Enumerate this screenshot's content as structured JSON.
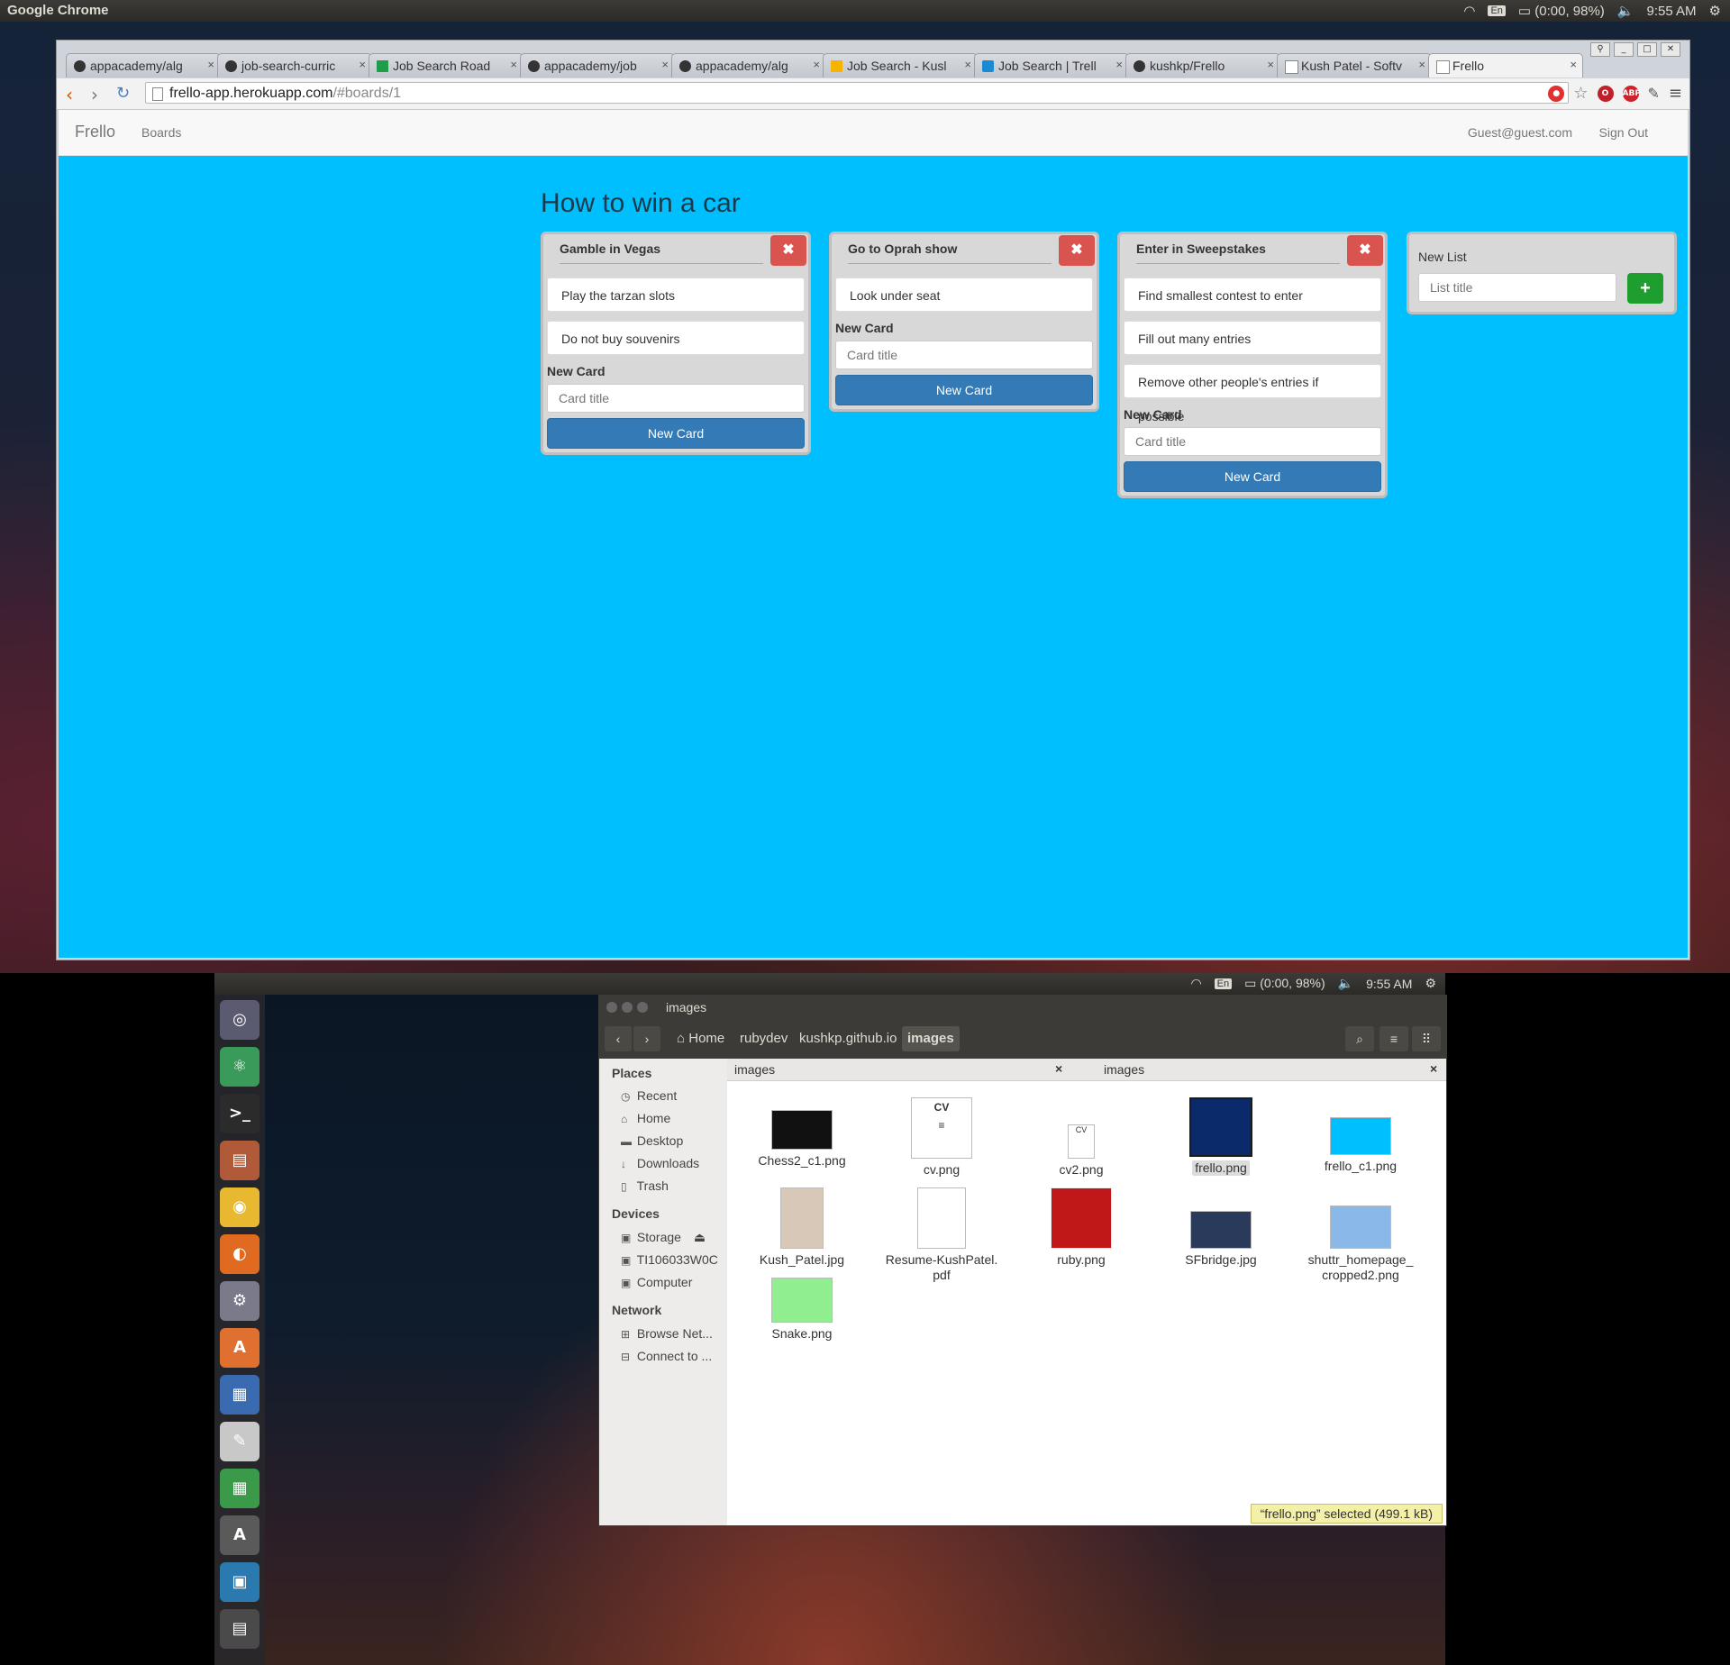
{
  "system": {
    "app_name": "Google Chrome",
    "kbd": "En",
    "battery": "(0:00, 98%)",
    "time": "9:55 AM"
  },
  "chrome": {
    "tabs": [
      {
        "label": "appacademy/alg",
        "icon": "github-icon"
      },
      {
        "label": "job-search-curric",
        "icon": "github-icon"
      },
      {
        "label": "Job Search Road",
        "icon": "sheets-icon"
      },
      {
        "label": "appacademy/job",
        "icon": "github-icon"
      },
      {
        "label": "appacademy/alg",
        "icon": "github-icon"
      },
      {
        "label": "Job Search - Kusl",
        "icon": "drive-icon"
      },
      {
        "label": "Job Search | Trell",
        "icon": "trello-icon"
      },
      {
        "label": "kushkp/Frello",
        "icon": "github-icon"
      },
      {
        "label": "Kush Patel - Softv",
        "icon": "doc-icon"
      },
      {
        "label": "Frello",
        "icon": "doc-icon"
      }
    ],
    "tab_close": "×",
    "url_host": "frello-app.herokuapp.com",
    "url_path": "/#boards/1"
  },
  "frello": {
    "brand": "Frello",
    "boards_link": "Boards",
    "user": "Guest@guest.com",
    "sign_out": "Sign Out",
    "board_title": "How to win a car",
    "new_card_label": "New Card",
    "card_placeholder": "Card title",
    "new_card_button": "New Card",
    "lists": [
      {
        "title": "Gamble in Vegas",
        "cards": [
          "Play the tarzan slots",
          "Do not buy souvenirs"
        ]
      },
      {
        "title": "Go to Oprah show",
        "cards": [
          "Look under seat"
        ]
      },
      {
        "title": "Enter in Sweepstakes",
        "cards": [
          "Find smallest contest to enter",
          "Fill out many entries",
          "Remove other people's entries if possible"
        ]
      }
    ],
    "new_list_label": "New List",
    "list_placeholder": "List title",
    "add_list_icon": "+"
  },
  "files": {
    "window_title": "images",
    "breadcrumbs": [
      "Home",
      "rubydev",
      "kushkp.github.io",
      "images"
    ],
    "sidebar": {
      "places_head": "Places",
      "places": [
        "Recent",
        "Home",
        "Desktop",
        "Downloads",
        "Trash"
      ],
      "devices_head": "Devices",
      "devices": [
        "Storage",
        "TI106033W0C",
        "Computer"
      ],
      "network_head": "Network",
      "network": [
        "Browse Net...",
        "Connect to ..."
      ]
    },
    "tabs": [
      "images",
      "images"
    ],
    "items": [
      {
        "name": "Chess2_c1.png"
      },
      {
        "name": "cv.png"
      },
      {
        "name": "cv2.png"
      },
      {
        "name": "frello.png"
      },
      {
        "name": "frello_c1.png"
      },
      {
        "name": "Kush_Patel.jpg"
      },
      {
        "name": "Resume-KushPatel.\npdf"
      },
      {
        "name": "ruby.png"
      },
      {
        "name": "SFbridge.jpg"
      },
      {
        "name": "shuttr_homepage_\ncropped2.png"
      },
      {
        "name": "Snake.png"
      }
    ],
    "status": "“frello.png” selected  (499.1 kB)"
  }
}
